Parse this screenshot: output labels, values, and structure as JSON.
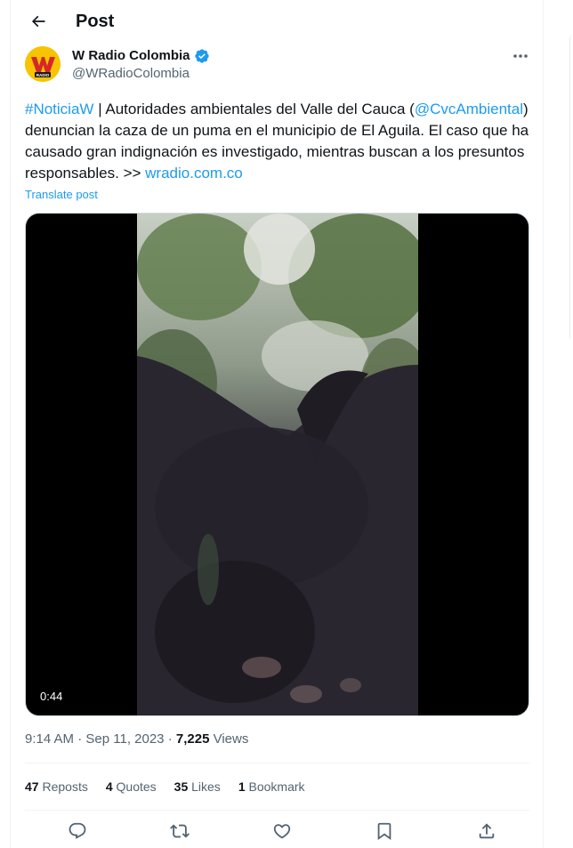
{
  "header": {
    "title": "Post",
    "back_icon": "arrow-left-icon"
  },
  "author": {
    "name": "W Radio Colombia",
    "handle": "@WRadioColombia",
    "verified": true,
    "verified_color": "#1d9bf0",
    "avatar_text": "RADIO"
  },
  "tweet": {
    "segments": [
      {
        "text": "#NoticiaW",
        "link": true
      },
      {
        "text": " | Autoridades ambientales del Valle del Cauca (",
        "link": false
      },
      {
        "text": "@CvcAmbiental",
        "link": true
      },
      {
        "text": ") denuncian la caza de un puma en el municipio de El Aguila. El caso que ha causado gran indignación es investigado, mientras buscan a los presuntos responsables. >> ",
        "link": false
      },
      {
        "text": "wradio.com.co",
        "link": true
      }
    ],
    "translate_label": "Translate post",
    "link_color": "#1d9bf0"
  },
  "media": {
    "type": "video",
    "duration": "0:44"
  },
  "meta": {
    "time": "9:14 AM",
    "date": "Sep 11, 2023",
    "views_count": "7,225",
    "views_label": "Views"
  },
  "stats": {
    "reposts_count": "47",
    "reposts_label": "Reposts",
    "quotes_count": "4",
    "quotes_label": "Quotes",
    "likes_count": "35",
    "likes_label": "Likes",
    "bookmarks_count": "1",
    "bookmarks_label": "Bookmark"
  },
  "actions": [
    "reply-icon",
    "repost-icon",
    "like-icon",
    "bookmark-icon",
    "share-icon"
  ]
}
